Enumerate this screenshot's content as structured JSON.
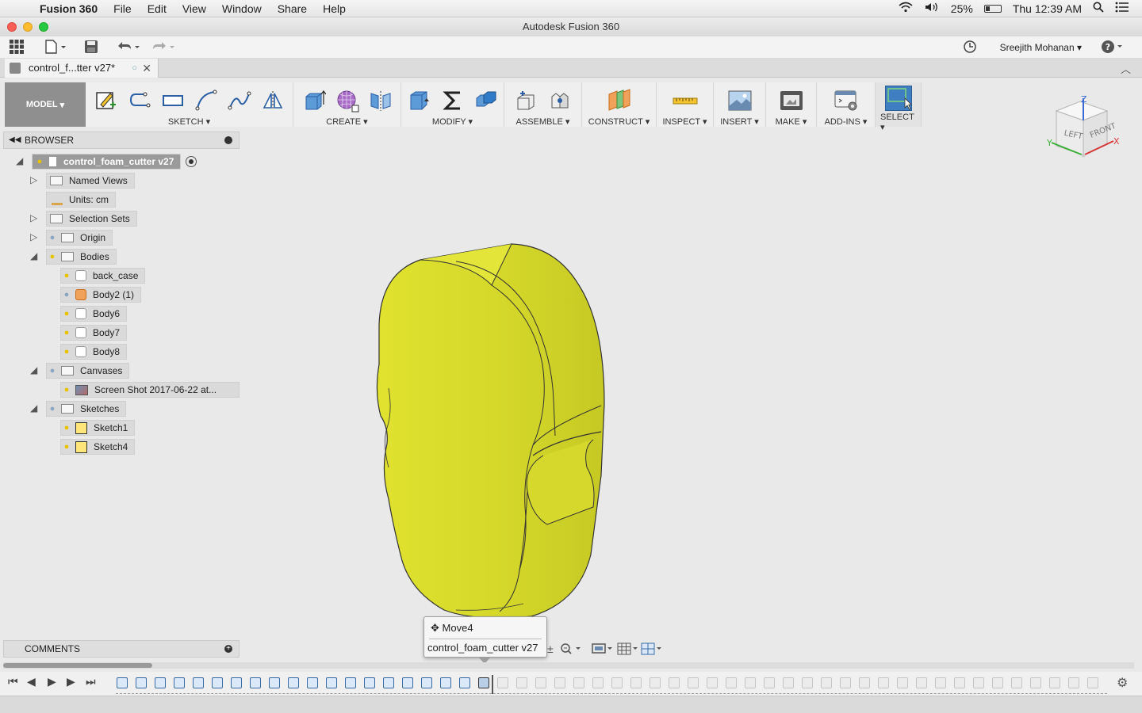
{
  "menubar": {
    "app_name": "Fusion 360",
    "items": [
      "File",
      "Edit",
      "View",
      "Window",
      "Share",
      "Help"
    ],
    "battery": "25%",
    "clock": "Thu 12:39 AM"
  },
  "window": {
    "title": "Autodesk Fusion 360"
  },
  "appbar": {
    "user": "Sreejith Mohanan"
  },
  "document_tab": {
    "name": "control_f...tter v27*"
  },
  "toolbar": {
    "workspace": "MODEL",
    "groups": [
      "SKETCH",
      "CREATE",
      "MODIFY",
      "ASSEMBLE",
      "CONSTRUCT",
      "INSPECT",
      "INSERT",
      "MAKE",
      "ADD-INS",
      "SELECT"
    ]
  },
  "viewcube": {
    "left": "LEFT",
    "front": "FRONT",
    "z": "Z",
    "x": "X",
    "y": "Y"
  },
  "browser": {
    "title": "BROWSER",
    "root": "control_foam_cutter v27",
    "items": {
      "named_views": "Named Views",
      "units": "Units: cm",
      "selection_sets": "Selection Sets",
      "origin": "Origin",
      "bodies": "Bodies",
      "back_case": "back_case",
      "body2": "Body2 (1)",
      "body6": "Body6",
      "body7": "Body7",
      "body8": "Body8",
      "canvases": "Canvases",
      "screenshot": "Screen Shot 2017-06-22 at...",
      "sketches": "Sketches",
      "sketch1": "Sketch1",
      "sketch4": "Sketch4"
    }
  },
  "comments": {
    "title": "COMMENTS"
  },
  "tooltip": {
    "feature": "Move4",
    "document": "control_foam_cutter v27"
  },
  "colors": {
    "body_yellow": "#d9dc2c",
    "accent_blue": "#3a6aa5"
  }
}
